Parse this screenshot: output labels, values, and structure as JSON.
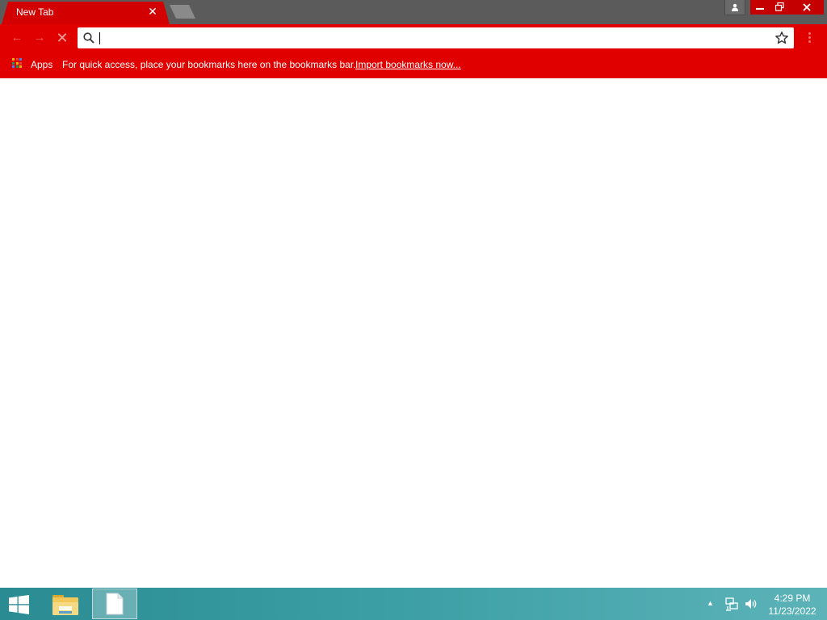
{
  "tabs": {
    "active_title": "New Tab",
    "close_glyph": "✕",
    "new_tab_icon": "new-tab-icon"
  },
  "window_controls": {
    "profile_icon": "person-icon",
    "minimize_glyph": "—",
    "maximize_glyph": "❐",
    "close_glyph": "✕"
  },
  "toolbar": {
    "back_glyph": "←",
    "forward_glyph": "→",
    "stop_glyph": "✕",
    "omnibox_value": "",
    "search_icon": "search-icon",
    "star_icon": "star-icon",
    "menu_icon": "more-vert-icon"
  },
  "bookmarks_bar": {
    "apps_label": "Apps",
    "prompt_text": "For quick access, place your bookmarks here on the bookmarks bar.",
    "import_link": "Import bookmarks now..."
  },
  "taskbar": {
    "start_icon": "windows-logo-icon",
    "pinned": [
      "file-explorer-icon",
      "document-icon"
    ],
    "tray_arrow_glyph": "▲",
    "clock_time": "4:29 PM",
    "clock_date": "11/23/2022"
  },
  "colors": {
    "tab_red": "#d20000",
    "toolbar_red": "#e00000",
    "tabstrip_gray": "#5b5b5b",
    "taskbar_teal": "#3a9ea4"
  }
}
